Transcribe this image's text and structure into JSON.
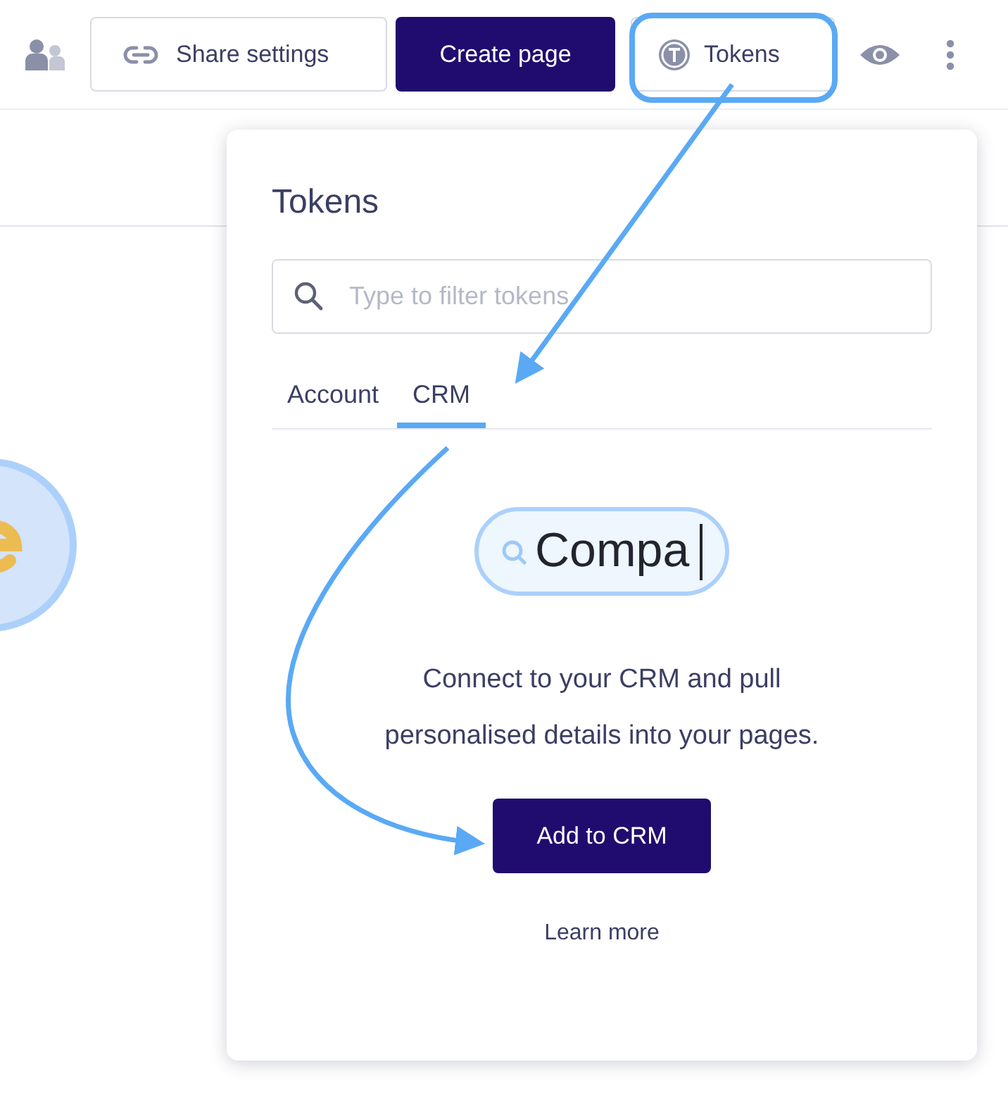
{
  "toolbar": {
    "share_button": {
      "label": "Share settings"
    },
    "create_button": {
      "label": "Create page"
    },
    "tokens_button": {
      "label": "Tokens",
      "highlighted": true
    }
  },
  "popover": {
    "title": "Tokens",
    "search": {
      "placeholder": "Type to filter tokens"
    },
    "tabs": [
      {
        "label": "Account",
        "selected": false
      },
      {
        "label": "CRM",
        "selected": true
      }
    ],
    "illustration": {
      "value": "Compa"
    },
    "message": "Connect to your CRM and pull personalised details into your pages.",
    "button": "Add to CRM",
    "link": "Learn more"
  }
}
